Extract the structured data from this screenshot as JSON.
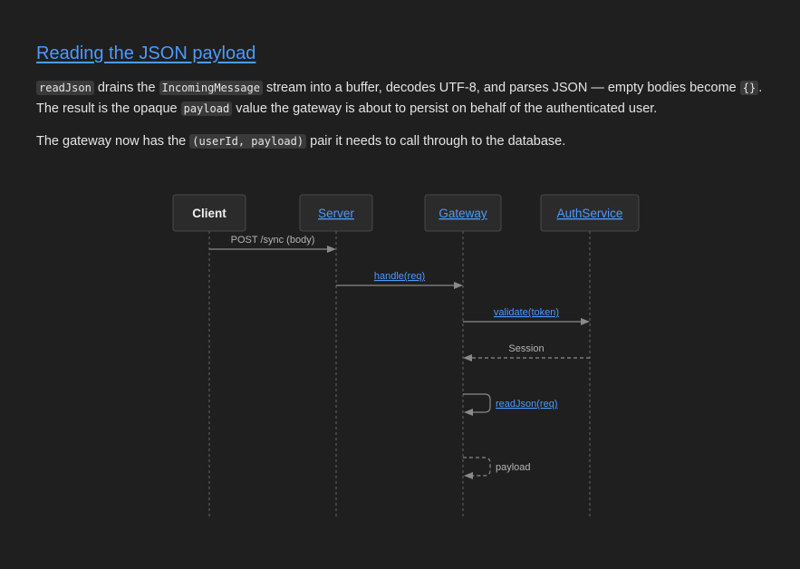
{
  "heading": "Reading the JSON payload",
  "para1": {
    "code1": "readJson",
    "t1": " drains the ",
    "code2": "IncomingMessage",
    "t2": " stream into a buffer, decodes UTF-8, and parses JSON — empty bodies become ",
    "code3": "{}",
    "t3": ". The result is the opaque ",
    "code4": "payload",
    "t4": " value the gateway is about to persist on behalf of the authenticated user."
  },
  "para2": {
    "t1": "The gateway now has the ",
    "code1": "(userId, payload)",
    "t2": " pair it needs to call through to the database."
  },
  "diagram": {
    "actors": [
      {
        "name": "Client",
        "link": false
      },
      {
        "name": "Server",
        "link": true
      },
      {
        "name": "Gateway",
        "link": true
      },
      {
        "name": "AuthService",
        "link": true
      }
    ],
    "messages": [
      {
        "from": 0,
        "to": 1,
        "label": "POST /sync (body)",
        "link": false,
        "style": "solid"
      },
      {
        "from": 1,
        "to": 2,
        "label": "handle(req)",
        "link": true,
        "style": "solid"
      },
      {
        "from": 2,
        "to": 3,
        "label": "validate(token)",
        "link": true,
        "style": "solid"
      },
      {
        "from": 3,
        "to": 2,
        "label": "Session",
        "link": false,
        "style": "dashed"
      },
      {
        "from": 2,
        "to": 2,
        "label": "readJson(req)",
        "link": true,
        "style": "solid"
      },
      {
        "from": 2,
        "to": 2,
        "label": "payload",
        "link": false,
        "style": "dashed"
      }
    ]
  }
}
